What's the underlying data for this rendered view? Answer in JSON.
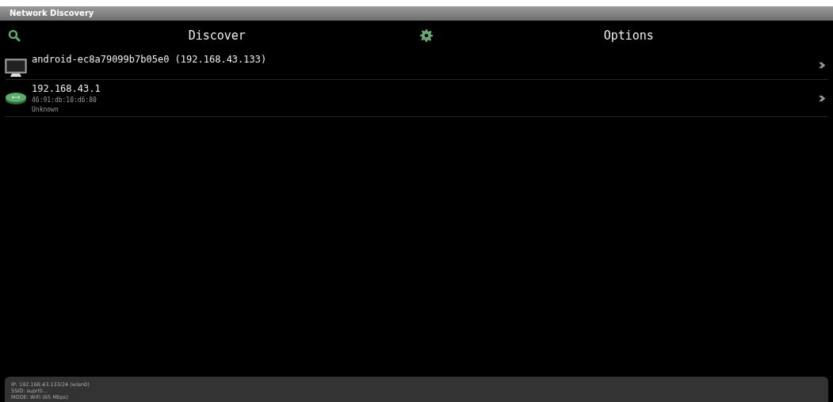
{
  "window": {
    "title": "Network Discovery"
  },
  "actions": [
    {
      "kind": "search",
      "label": "Discover"
    },
    {
      "kind": "settings",
      "label": "Options"
    }
  ],
  "hosts": [
    {
      "kind": "computer",
      "lines": [
        "android-ec8a79099b7b05e0 (192.168.43.133)"
      ]
    },
    {
      "kind": "router",
      "lines": [
        "192.168.43.1",
        "46:91:db:10:d6:80",
        "Unknown"
      ]
    }
  ],
  "status_bar": [
    "IP: 192.168.43.133/24 (wlan0)",
    "SSID: supriti...",
    "MODE: WiFi (65 Mbps)"
  ]
}
